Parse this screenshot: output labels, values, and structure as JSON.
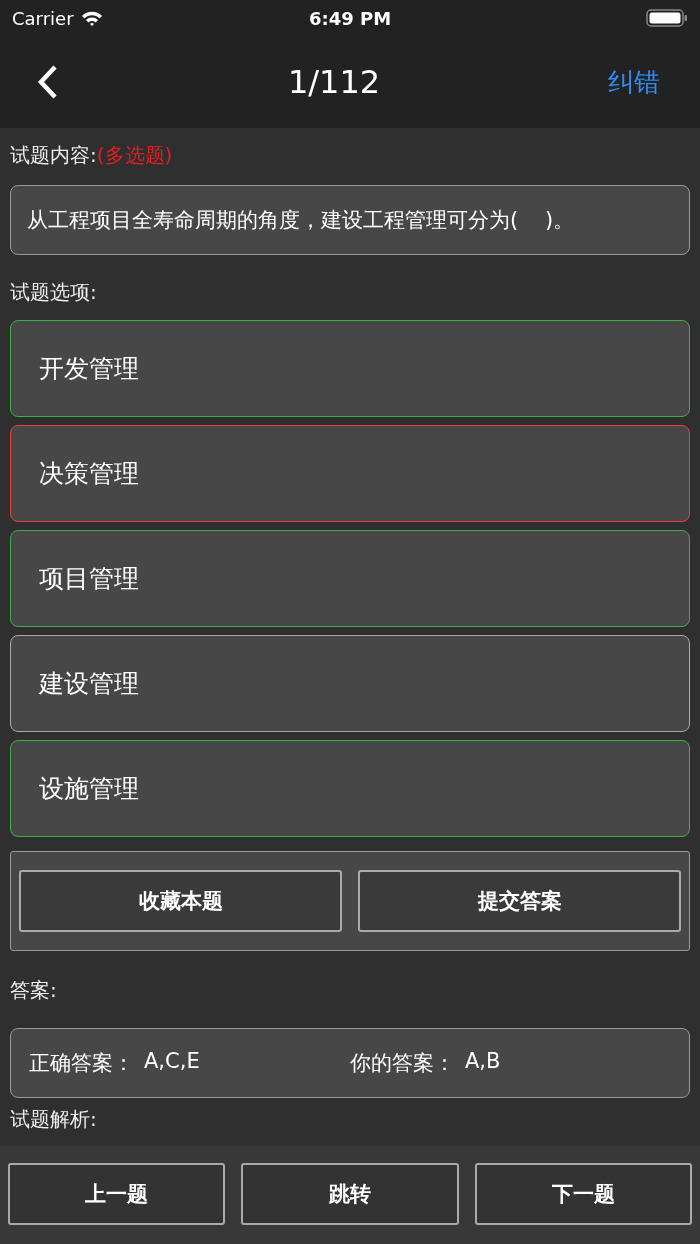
{
  "status_bar": {
    "carrier": "Carrier",
    "time": "6:49 PM"
  },
  "nav": {
    "title": "1/112",
    "action": "纠错"
  },
  "question": {
    "label": "试题内容:",
    "type": "(多选题)",
    "text": "从工程项目全寿命周期的角度，建设工程管理可分为(    )。"
  },
  "options_label": "试题选项:",
  "options": [
    {
      "text": "开发管理",
      "kind": "correct"
    },
    {
      "text": "决策管理",
      "kind": "wrong"
    },
    {
      "text": "项目管理",
      "kind": "correct"
    },
    {
      "text": "建设管理",
      "kind": "plain"
    },
    {
      "text": "设施管理",
      "kind": "correct"
    }
  ],
  "actions": [
    "收藏本题",
    "提交答案"
  ],
  "answer": {
    "label": "答案:",
    "correct_label": "正确答案：",
    "correct": "A,C,E",
    "yours_label": "你的答案：",
    "yours": "A,B"
  },
  "analysis_label": "试题解析:",
  "bottom_buttons": [
    "上一题",
    "跳转",
    "下一题"
  ]
}
